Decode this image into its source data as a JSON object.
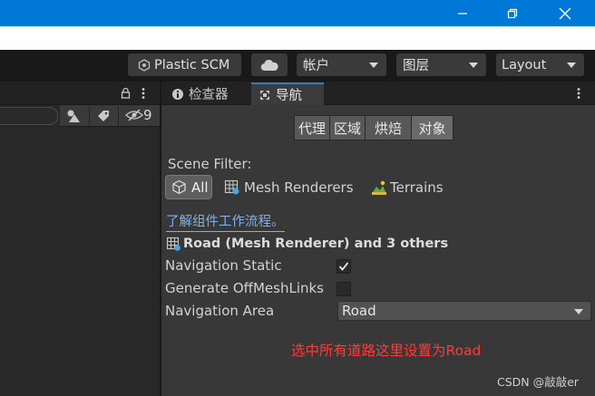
{
  "window": {
    "controls": [
      "minimize-icon",
      "restore-icon",
      "close-icon"
    ]
  },
  "toolbar": {
    "plastic_scm": "Plastic SCM",
    "account": "帐户",
    "layers": "图层",
    "layout": "Layout"
  },
  "hierarchy": {
    "hidden_count": "9"
  },
  "tabs": [
    {
      "label": "检查器",
      "active": false
    },
    {
      "label": "导航",
      "active": true
    }
  ],
  "nav_modes": [
    {
      "label": "代理",
      "active": false
    },
    {
      "label": "区域",
      "active": false
    },
    {
      "label": "烘焙",
      "active": false
    },
    {
      "label": "对象",
      "active": true
    }
  ],
  "scene_filter": {
    "label": "Scene Filter:",
    "options": [
      {
        "label": "All",
        "selected": true
      },
      {
        "label": "Mesh Renderers",
        "selected": false
      },
      {
        "label": "Terrains",
        "selected": false
      }
    ]
  },
  "help_link": "了解组件工作流程。",
  "object": {
    "title": "Road (Mesh Renderer) and 3 others",
    "navigation_static": {
      "label": "Navigation Static",
      "checked": true
    },
    "generate_offmesh": {
      "label": "Generate OffMeshLinks",
      "checked": false
    },
    "navigation_area": {
      "label": "Navigation Area",
      "value": "Road"
    }
  },
  "annotation": "选中所有道路这里设置为Road",
  "watermark": "CSDN @敲敲er",
  "colors": {
    "title_bar": "#0078d7",
    "accent_tab": "#3a79bb",
    "link": "#7fb0ea",
    "annotation": "#ff3b3b"
  }
}
